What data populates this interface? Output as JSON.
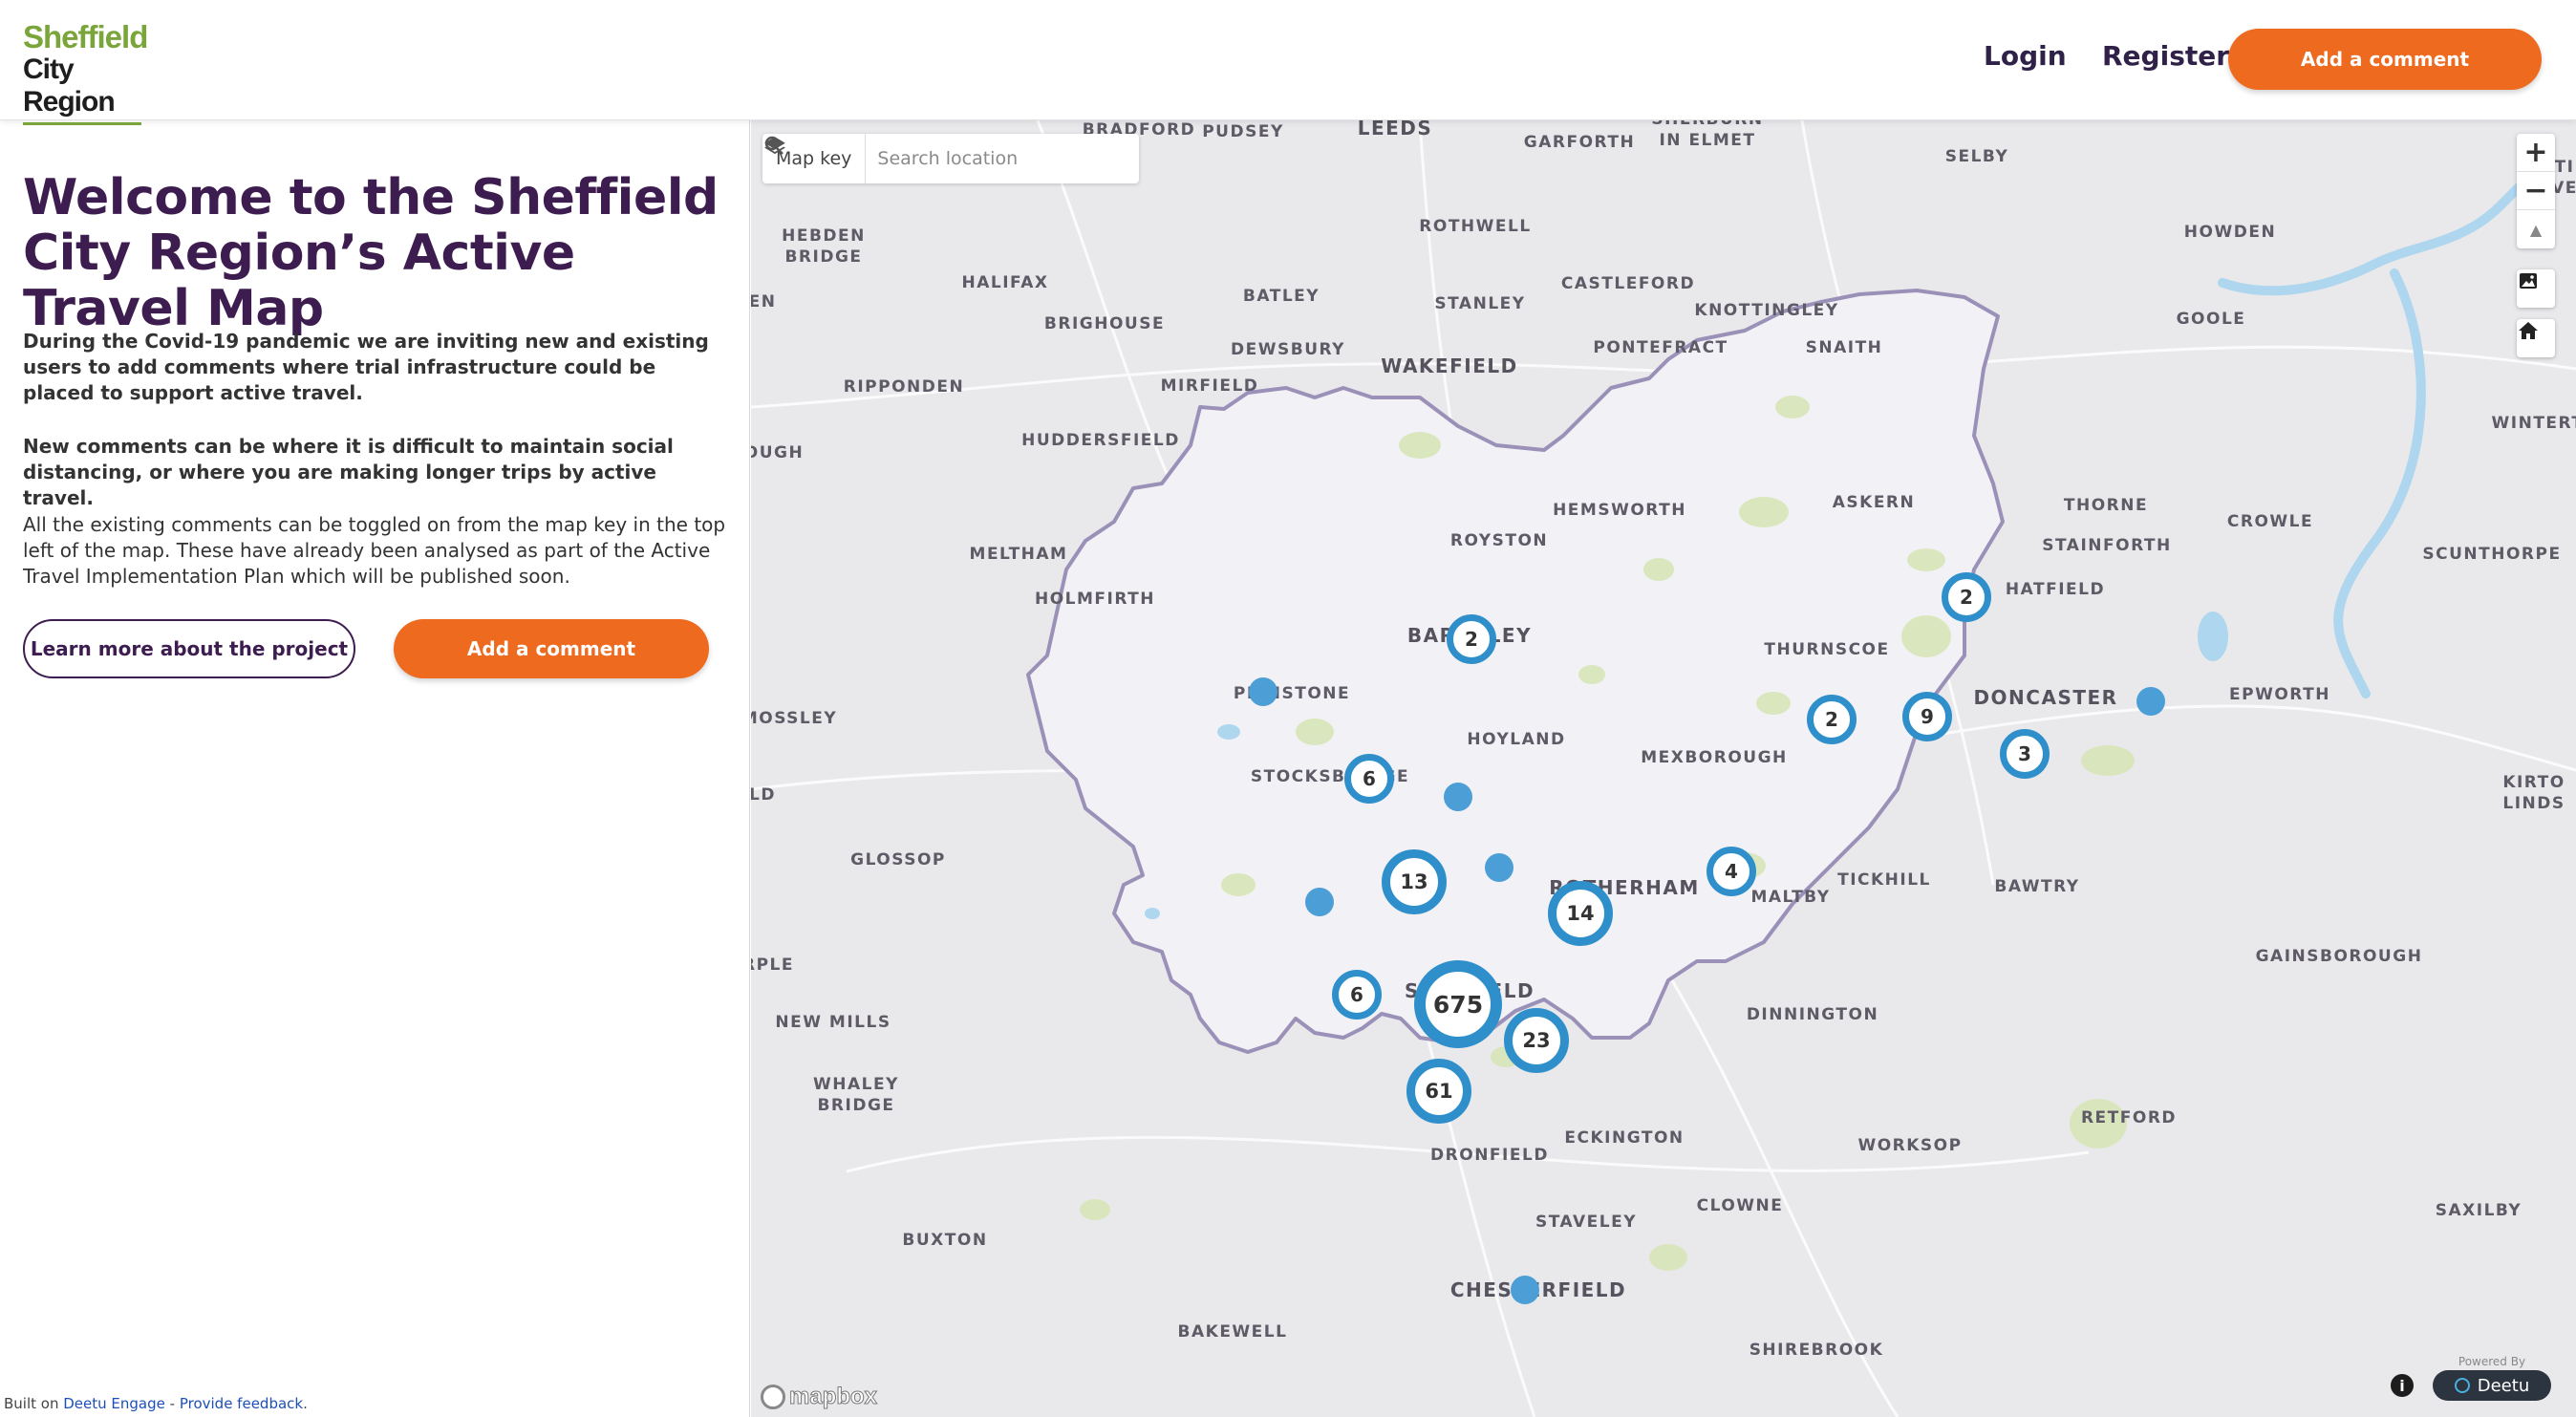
{
  "header": {
    "logo_line1": "Sheffield",
    "logo_line2": "City Region",
    "login": "Login",
    "register": "Register",
    "add_comment": "Add a comment"
  },
  "panel": {
    "title": "Welcome to the Sheffield City Region’s Active Travel Map",
    "p1": "During the Covid-19 pandemic we are inviting new and existing users to add comments where trial infrastructure could be placed to support active travel.",
    "p2": "New comments can be where it is difficult to maintain social distancing, or where you are making longer trips by active travel.",
    "p3": "All the existing comments can be toggled on from the map key in the top left of the map. These have already been analysed as part of the Active Travel Implementation Plan which will be published soon.",
    "learn_more": "Learn more about the project",
    "add_comment": "Add a comment"
  },
  "footer": {
    "built_on": "Built on",
    "engage": "Deetu Engage",
    "sep": " - ",
    "feedback": "Provide feedback",
    "dot": "."
  },
  "map": {
    "map_key": "Map key",
    "search_placeholder": "Search location",
    "zoom_in": "+",
    "zoom_out": "−",
    "compass": "▲",
    "attribution": "mapbox",
    "info": "i",
    "powered_by": "Powered By",
    "powered_brand": "Deetu",
    "colors": {
      "boundary": "#9b91b8",
      "region_fill": "#f2f2f6",
      "cluster": "#2f8fcb",
      "point": "#4c9ed6",
      "water": "#aed6ee"
    },
    "clusters": [
      {
        "label": "2",
        "size": "s"
      },
      {
        "label": "2",
        "size": "s"
      },
      {
        "label": "9",
        "size": "s"
      },
      {
        "label": "2",
        "size": "s"
      },
      {
        "label": "3",
        "size": "s"
      },
      {
        "label": "6",
        "size": "s"
      },
      {
        "label": "4",
        "size": "s"
      },
      {
        "label": "13",
        "size": "m"
      },
      {
        "label": "14",
        "size": "m"
      },
      {
        "label": "6",
        "size": "s"
      },
      {
        "label": "675",
        "size": "l"
      },
      {
        "label": "23",
        "size": "m"
      },
      {
        "label": "61",
        "size": "m"
      }
    ],
    "place_labels": [
      "BRADFORD",
      "PUDSEY",
      "LEEDS",
      "GARFORTH",
      "SHERBURN\nIN ELMET",
      "SELBY",
      "HEBDEN\nBRIDGE",
      "HALIFAX",
      "BATLEY",
      "ROTHWELL",
      "STANLEY",
      "CASTLEFORD",
      "KNOTTINGLEY",
      "HOWDEN",
      "GOOLE",
      "BRIGHOUSE",
      "DEWSBURY",
      "PONTEFRACT",
      "SNAITH",
      "RIPPONDEN",
      "MIRFIELD",
      "WAKEFIELD",
      "HUDDERSFIELD",
      "WINTERT",
      "HEMSWORTH",
      "ASKERN",
      "THORNE",
      "CROWLE",
      "MELTHAM",
      "ROYSTON",
      "STAINFORTH",
      "SCUNTHORPE",
      "HOLMFIRTH",
      "HATFIELD",
      "BARNSLEY",
      "THURNSCOE",
      "PENISTONE",
      "DONCASTER",
      "EPWORTH",
      "MOSSLEY",
      "HOYLAND",
      "MEXBOROUGH",
      "STOCKSBRIDGE",
      "KIRTO\nLINDS",
      "GLOSSOP",
      "ROTHERHAM",
      "MALTBY",
      "TICKHILL",
      "BAWTRY",
      "GAINSBOROUGH",
      "SHEFFIELD",
      "NEW MILLS",
      "DINNINGTON",
      "WHALEY\nBRIDGE",
      "RETFORD",
      "ECKINGTON",
      "DRONFIELD",
      "WORKSOP",
      "CLOWNE",
      "STAVELEY",
      "SAXILBY",
      "BUXTON",
      "CHESTERFIELD",
      "BAKEWELL",
      "SHIREBROOK",
      "OUGH",
      "EN",
      "LD",
      "RPLE",
      "TI\nVE"
    ]
  }
}
